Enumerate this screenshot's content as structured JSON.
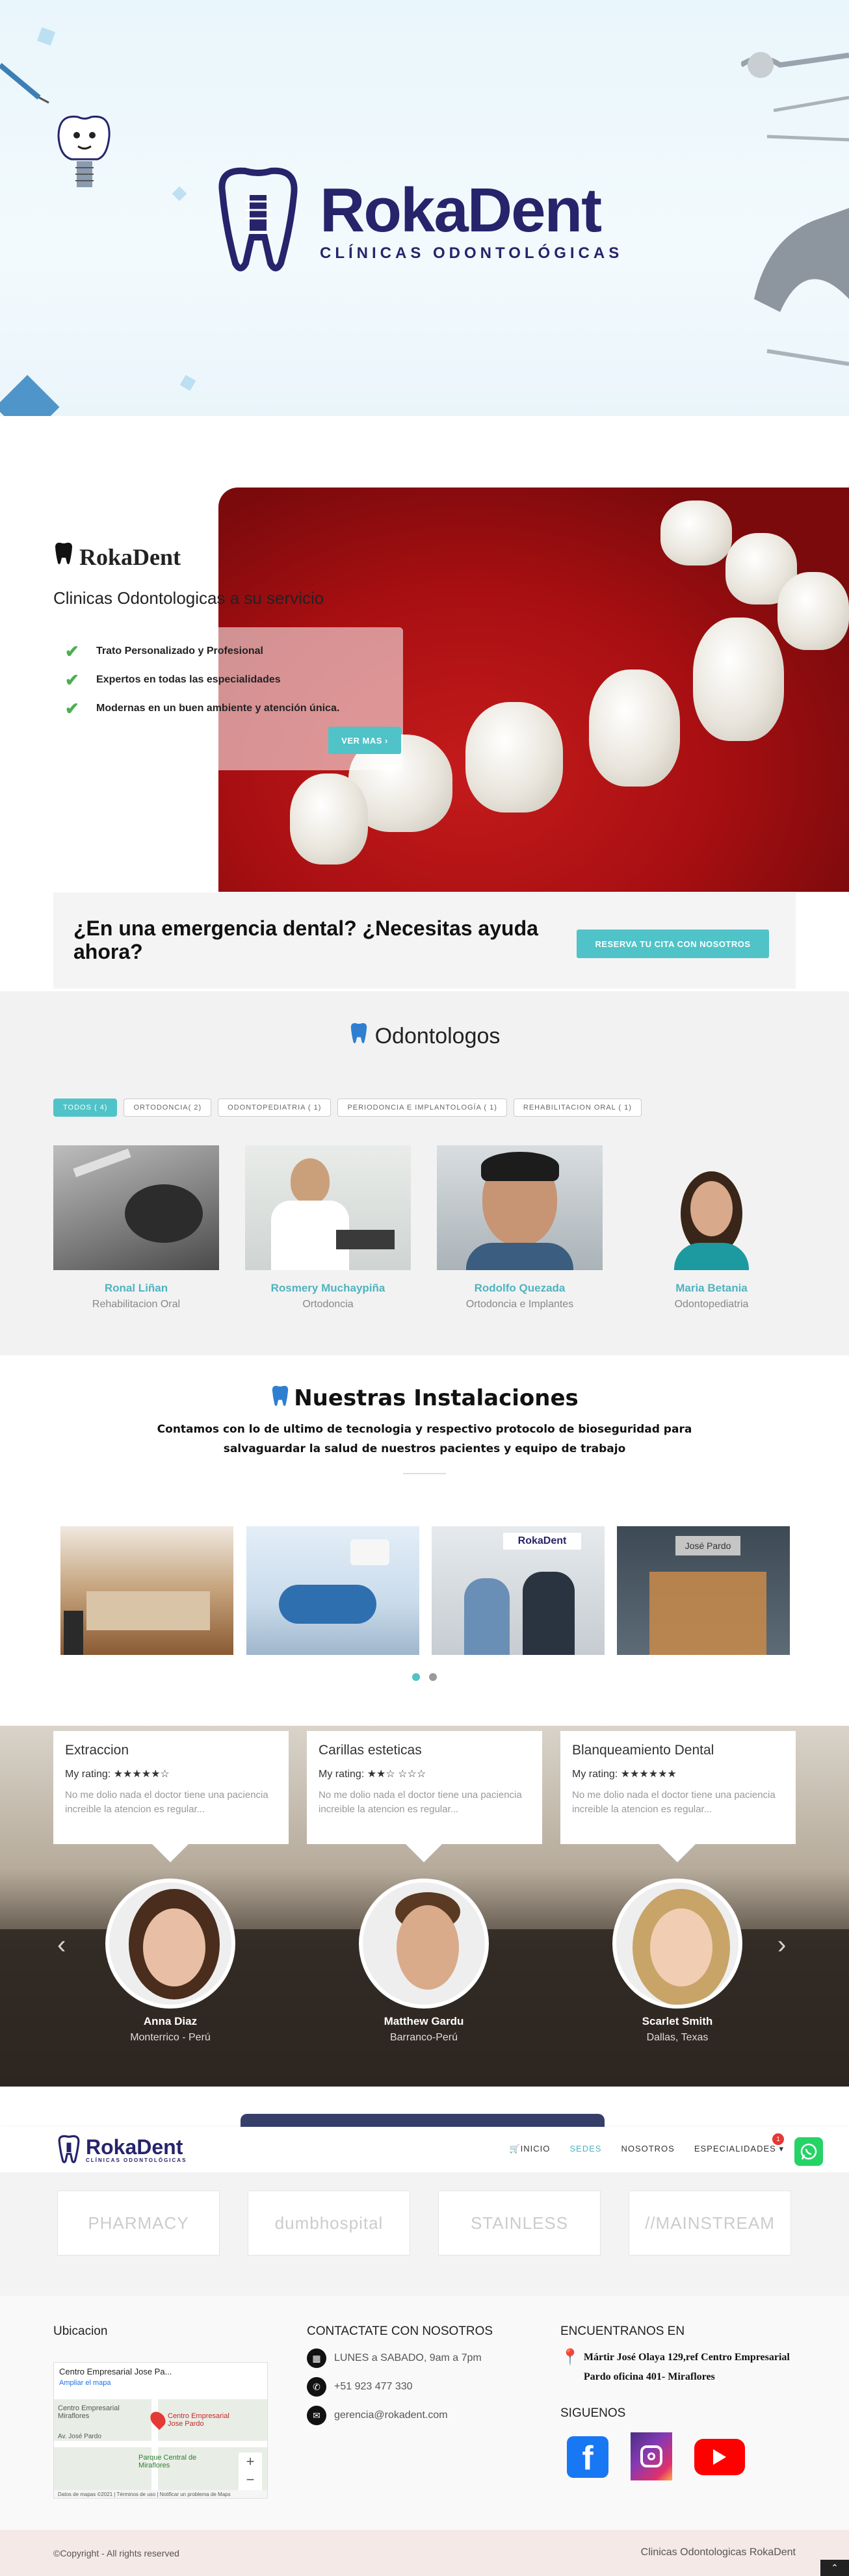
{
  "hero": {
    "brand": "RokaDent",
    "tagline": "CLÍNICAS ODONTOLÓGICAS"
  },
  "intro": {
    "brand": "RokaDent",
    "subtitle": "Clinicas Odontologicas a su servicio",
    "features": [
      "Trato Personalizado y Profesional",
      "Expertos en todas las especialidades",
      "Modernas en un buen ambiente y atención única."
    ],
    "button": "VER MAS ›"
  },
  "emergency": {
    "text": "¿En una emergencia dental? ¿Necesitas ayuda ahora?",
    "button": "RESERVA TU CITA CON NOSOTROS"
  },
  "doctors": {
    "title": "Odontologos",
    "filters": [
      "TODOS ( 4)",
      "ORTODONCIA( 2)",
      "ODONTOPEDIATRIA ( 1)",
      "PERIODONCIA E IMPLANTOLOGÍA ( 1)",
      "REHABILITACION ORAL ( 1)"
    ],
    "items": [
      {
        "name": "Ronal Liñan",
        "spec": "Rehabilitacion Oral"
      },
      {
        "name": "Rosmery Muchaypiña",
        "spec": "Ortodoncia"
      },
      {
        "name": "Rodolfo Quezada",
        "spec": "Ortodoncia e Implantes"
      },
      {
        "name": "Maria Betania",
        "spec": "Odontopediatria"
      }
    ]
  },
  "facilities": {
    "title": "Nuestras Instalaciones",
    "text": "Contamos con lo de ultimo de tecnologia y respectivo protocolo de bioseguridad para salvaguardar la salud de nuestros pacientes y equipo de trabajo",
    "photo3_sign": "RokaDent",
    "photo4_sign": "José Pardo"
  },
  "testimonials": [
    {
      "title": "Extraccion",
      "rating": "My rating: ★★★★★☆",
      "quote": "No me dolio nada el doctor tiene una paciencia increible la atencion es regular...",
      "name": "Anna Diaz",
      "location": "Monterrico - Perú"
    },
    {
      "title": "Carillas esteticas",
      "rating": "My rating: ★★☆ ☆☆☆",
      "quote": "No me dolio nada el doctor tiene una paciencia increible la atencion es regular...",
      "name": "Matthew Gardu",
      "location": "Barranco-Perú"
    },
    {
      "title": "Blanqueamiento Dental",
      "rating": "My rating: ★★★★★★",
      "quote": "No me dolio nada el doctor tiene una paciencia increible la atencion es regular...",
      "name": "Scarlet Smith",
      "location": "Dallas, Texas"
    }
  ],
  "nav": {
    "brand": "RokaDent",
    "brand_sub": "CLÍNICAS ODONTOLÓGICAS",
    "items": [
      "INICIO",
      "SEDES",
      "NOSOTROS",
      "ESPECIALIDADES"
    ],
    "badge": "1"
  },
  "partners": [
    "PHARMACY",
    "dumbhospital",
    "STAINLESS",
    "//MAINSTREAM"
  ],
  "footer": {
    "col1_title": "Ubicacion",
    "map_place": "Centro Empresarial Jose Pa...",
    "map_link": "Ampliar el mapa",
    "map_pin": "Centro Empresarial Jose Pardo",
    "map_label1": "Centro Empresarial Miraflores",
    "map_label2": "Parque Central de Miraflores",
    "map_street": "Av. José Pardo",
    "map_footer": "Datos de mapas ©2021 | Términos de uso | Notificar un problema de Maps",
    "col2_title": "CONTACTATE CON NOSOTROS",
    "hours": "LUNES a SABADO, 9am a 7pm",
    "phone": "+51 923 477 330",
    "email": "gerencia@rokadent.com",
    "col3_title": "ENCUENTRANOS EN",
    "address": "Mártir José Olaya 129,ref Centro Empresarial Pardo oficina 401- Miraflores",
    "follow": "SIGUENOS"
  },
  "copyright": {
    "left": "©Copyright - All rights reserved",
    "right": "Clinicas Odontologicas RokaDent"
  },
  "colors": {
    "brand": "#26246b",
    "accent": "#4fc3c8",
    "whatsapp": "#25d366",
    "facebook": "#1877f2",
    "youtube": "#ff0000"
  }
}
